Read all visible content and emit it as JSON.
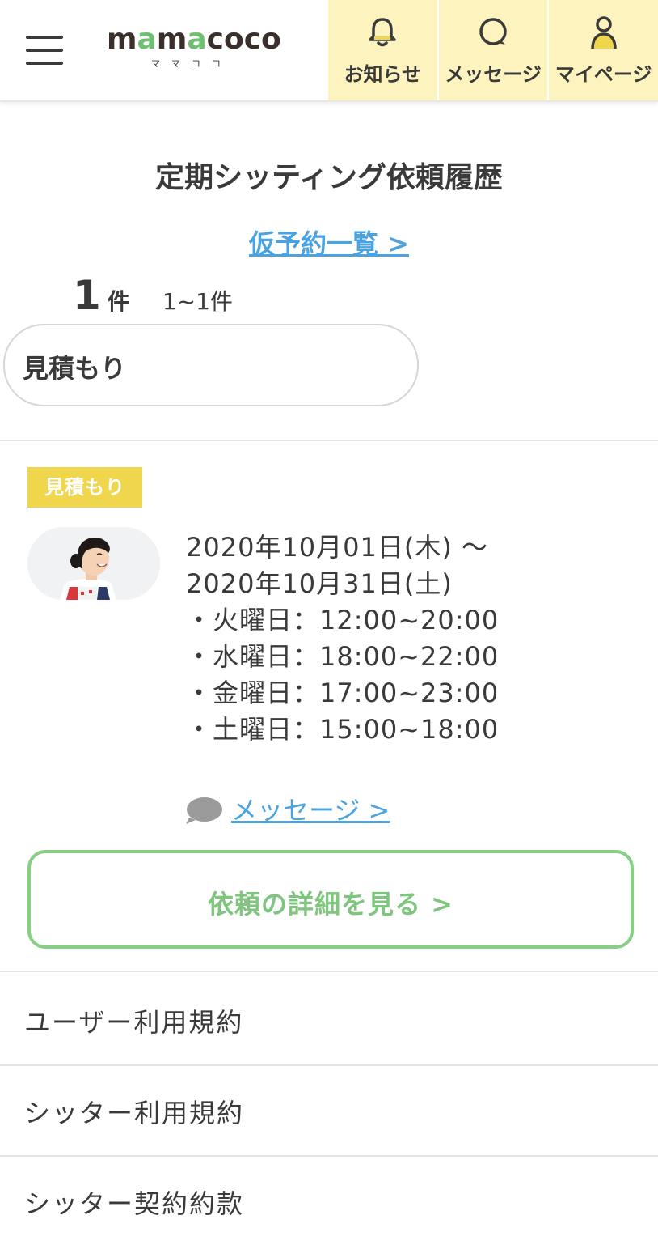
{
  "header": {
    "logo_text": "mamacoco",
    "logo_sub": "ママココ",
    "nav": [
      {
        "label": "お知らせ",
        "icon": "bell-icon"
      },
      {
        "label": "メッセージ",
        "icon": "chat-icon"
      },
      {
        "label": "マイページ",
        "icon": "person-icon"
      }
    ],
    "nav_bg": "#fdf3be"
  },
  "page": {
    "title": "定期シッティング依頼履歴",
    "provisional_link": "仮予約一覧 >",
    "count_number": "1",
    "count_unit": "件",
    "count_range": "1~1件",
    "filter_value": "見積もり"
  },
  "card": {
    "badge": "見積もり",
    "badge_color": "#efd64d",
    "date_start": "2020年10月01日(木) 〜",
    "date_end": "2020年10月31日(土)",
    "schedule": [
      "・火曜日：12:00~20:00",
      "・水曜日：18:00~22:00",
      "・金曜日：17:00~23:00",
      "・土曜日：15:00~18:00"
    ],
    "message_link": "メッセージ >",
    "detail_button": "依頼の詳細を見る >"
  },
  "footer": {
    "items": [
      "ユーザー利用規約",
      "シッター利用規約",
      "シッター契約約款"
    ]
  }
}
